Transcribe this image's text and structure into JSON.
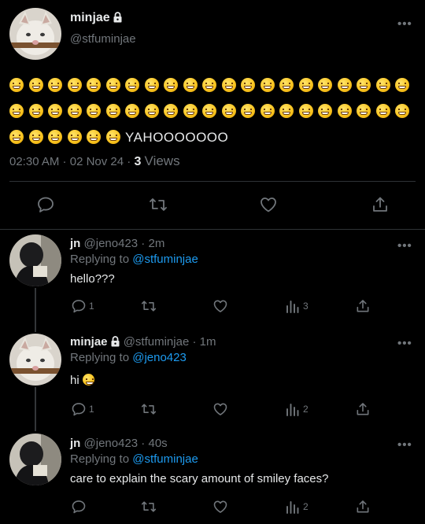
{
  "colors": {
    "background": "#000000",
    "text": "#e7e9ea",
    "muted": "#71767b",
    "link": "#1d9bf0",
    "divider": "#2f3336"
  },
  "main_tweet": {
    "display_name": "minjae",
    "protected_icon": "lock-icon",
    "handle": "@stfuminjae",
    "smiley_count": 48,
    "text": "YAHOOOOOOO",
    "time": "02:30 AM",
    "date": "02 Nov 24",
    "views_count": "3",
    "views_label": "Views",
    "actions": [
      "reply-icon",
      "retweet-icon",
      "like-icon",
      "share-icon"
    ]
  },
  "replies": [
    {
      "display_name": "jn",
      "handle": "@jeno423",
      "age": "2m",
      "replying_prefix": "Replying to",
      "replying_to": "@stfuminjae",
      "text": "hello???",
      "reply_count": "1",
      "views_count": "3"
    },
    {
      "display_name": "minjae",
      "handle": "@stfuminjae",
      "age": "1m",
      "replying_prefix": "Replying to",
      "replying_to": "@jeno423",
      "text": "hi",
      "reply_count": "1",
      "views_count": "2"
    },
    {
      "display_name": "jn",
      "handle": "@jeno423",
      "age": "40s",
      "replying_prefix": "Replying to",
      "replying_to": "@stfuminjae",
      "text": "care to explain the scary amount of smiley faces?",
      "reply_count": "",
      "views_count": "2"
    }
  ]
}
